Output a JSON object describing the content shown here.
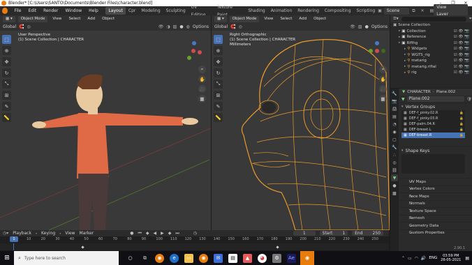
{
  "window": {
    "title": "Blender* [C:\\Users\\SANTO\\Documents\\Blender Files\\character.blend]",
    "controls": [
      "–",
      "❐",
      "✕"
    ]
  },
  "menu": {
    "items": [
      "File",
      "Edit",
      "Render",
      "Window",
      "Help"
    ],
    "workspaces": [
      "Layout",
      "Cpr",
      "Modeling",
      "Sculpting",
      "UV Editing",
      "Texture Paint",
      "Shading",
      "Animation",
      "Rendering",
      "Compositing",
      "Scripting"
    ],
    "active_workspace": "Layout",
    "scene": "Scene",
    "view_layer": "View Layer"
  },
  "left_viewport": {
    "mode": "Object Mode",
    "menus": [
      "View",
      "Select",
      "Add",
      "Object"
    ],
    "transform": "Global",
    "options": "Options",
    "view_name": "User Perspective",
    "collection": "(1) Scene Collection | CHARACTER"
  },
  "right_viewport": {
    "mode": "Object Mode",
    "menus": [
      "View",
      "Select",
      "Add",
      "Object"
    ],
    "transform": "Global",
    "options": "Options",
    "view_name": "Right Orthographic",
    "collection": "(1) Scene Collection | CHARACTER",
    "units": "Millimeters"
  },
  "outliner": {
    "title": "Scene Collection",
    "items": [
      {
        "label": "Collection",
        "indent": 1
      },
      {
        "label": "Reference",
        "indent": 1
      },
      {
        "label": "Rifihg",
        "indent": 1
      },
      {
        "label": "Widgets",
        "indent": 2
      },
      {
        "label": "WGTS_rig",
        "indent": 2
      },
      {
        "label": "metarig",
        "indent": 2
      },
      {
        "label": "metarig.rifial",
        "indent": 2
      },
      {
        "label": "rig",
        "indent": 2
      }
    ]
  },
  "properties": {
    "object_name": "CHARACTER",
    "mesh_name": "Plane.002",
    "data_name": "Plane.002",
    "vertex_groups_title": "Vertex Groups",
    "vertex_groups": [
      "DEF-f_pinky.02.R",
      "DEF-f_pinky.03.R",
      "DEF-palm.04.R",
      "DEF-breast.L",
      "DEF-breast.R"
    ],
    "selected_group": "DEF-breast.R",
    "shape_keys_title": "Shape Keys",
    "sections": [
      "UV Maps",
      "Vertex Colors",
      "Face Maps",
      "Normals",
      "Texture Space",
      "Remesh",
      "Geometry Data",
      "Custom Properties"
    ]
  },
  "timeline": {
    "menus": [
      "Playback",
      "Keying",
      "View",
      "Marker"
    ],
    "current_frame": "1",
    "start_label": "Start",
    "start": "1",
    "end_label": "End",
    "end": "250",
    "ruler": [
      "10",
      "20",
      "30",
      "40",
      "50",
      "60",
      "70",
      "80",
      "90",
      "100",
      "110",
      "120",
      "130",
      "140",
      "150",
      "160",
      "170",
      "180",
      "190",
      "200",
      "210",
      "220",
      "230",
      "240",
      "250"
    ],
    "version": "2.90.1"
  },
  "taskbar": {
    "search_placeholder": "Type here to search",
    "time": "03:59 PM",
    "date": "26-05-2021",
    "language": "ENG"
  },
  "colors": {
    "accent": "#4772b3",
    "wire": "#e89a2c",
    "shirt": "#e06a45",
    "pants": "#4a3a3a",
    "skin": "#e8c9a0"
  }
}
